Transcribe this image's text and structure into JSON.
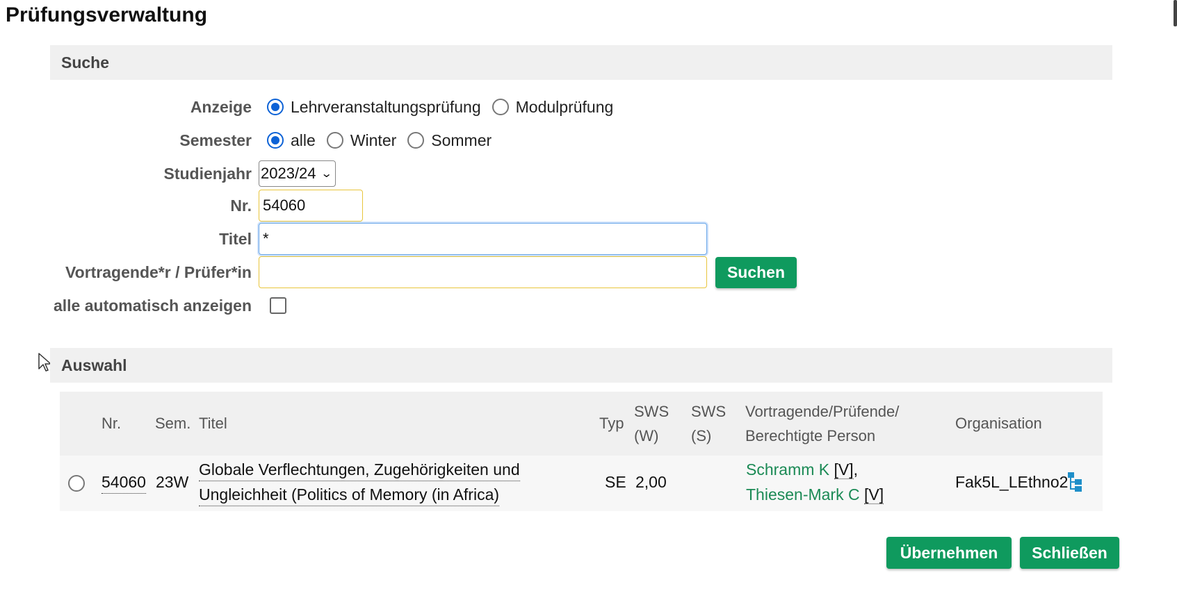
{
  "page": {
    "title": "Prüfungsverwaltung"
  },
  "search": {
    "header": "Suche",
    "anzeige": {
      "label": "Anzeige",
      "options": [
        {
          "label": "Lehrveranstaltungsprüfung",
          "checked": true
        },
        {
          "label": "Modulprüfung",
          "checked": false
        }
      ]
    },
    "semester": {
      "label": "Semester",
      "options": [
        {
          "label": "alle",
          "checked": true
        },
        {
          "label": "Winter",
          "checked": false
        },
        {
          "label": "Sommer",
          "checked": false
        }
      ]
    },
    "studienjahr": {
      "label": "Studienjahr",
      "value": "2023/24"
    },
    "nr": {
      "label": "Nr.",
      "value": "54060"
    },
    "titel": {
      "label": "Titel",
      "value": "*"
    },
    "vortragende": {
      "label": "Vortragende*r / Prüfer*in",
      "value": ""
    },
    "auto": {
      "label": "alle automatisch anzeigen",
      "checked": false
    },
    "search_button": "Suchen"
  },
  "selection": {
    "header": "Auswahl",
    "columns": {
      "nr": "Nr.",
      "sem": "Sem.",
      "titel": "Titel",
      "typ": "Typ",
      "sws_w_1": "SWS",
      "sws_w_2": "(W)",
      "sws_s_1": "SWS",
      "sws_s_2": "(S)",
      "vortr_1": "Vortragende/Prüfende/",
      "vortr_2": "Berechtigte Person",
      "org": "Organisation"
    },
    "rows": [
      {
        "selected": false,
        "nr": "54060",
        "sem": "23W",
        "title_line1": "Globale Verflechtungen, Zugehörigkeiten und",
        "title_line2": "Ungleichheit (Politics of Memory (in Africa)",
        "typ": "SE",
        "sws_w": "2,00",
        "sws_s": "",
        "person1": "Schramm K",
        "person1_role": "[V]",
        "person2": "Thiesen-Mark C",
        "person2_role": "[V]",
        "org": "Fak5L_LEthno2"
      }
    ]
  },
  "footer": {
    "apply_button": "Übernehmen",
    "close_button": "Schließen"
  },
  "colors": {
    "accent": "#0f9a5e",
    "link": "#1b8a55",
    "radio": "#0d62d6",
    "header_bg": "#f0f0f0"
  },
  "icons": {
    "cursor": "mouse-pointer-icon",
    "org": "org-tree-icon"
  }
}
